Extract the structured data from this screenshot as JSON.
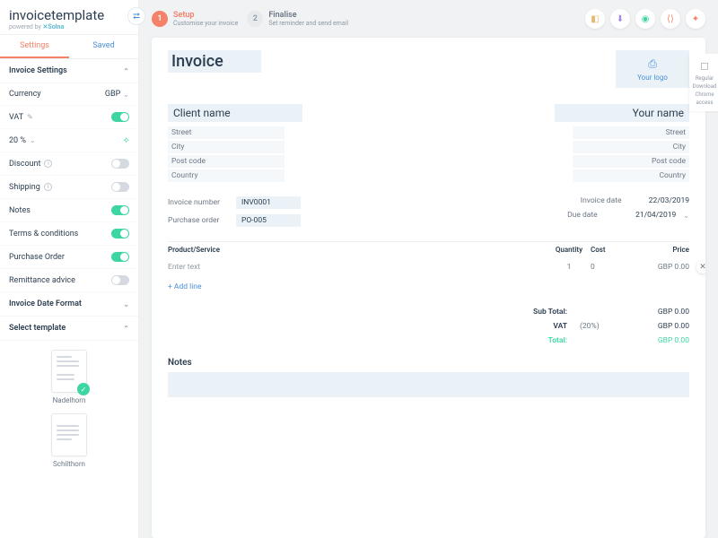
{
  "logo": {
    "name": "invoicetemplate",
    "powered_prefix": "powered by ",
    "powered_brand": "Solna"
  },
  "tabs": {
    "settings": "Settings",
    "saved": "Saved"
  },
  "sections": {
    "invoice_settings": "Invoice Settings",
    "invoice_date_format": "Invoice Date Format",
    "select_template": "Select template"
  },
  "settings": {
    "currency": {
      "label": "Currency",
      "value": "GBP"
    },
    "vat": {
      "label": "VAT",
      "percent": "20 %"
    },
    "discount": "Discount",
    "shipping": "Shipping",
    "notes": "Notes",
    "terms": "Terms & conditions",
    "po": "Purchase Order",
    "remittance": "Remittance advice"
  },
  "templates": {
    "nadelhorn": "Nadelhorn",
    "schilthorn": "Schilthorn"
  },
  "steps": {
    "s1": {
      "num": "1",
      "title": "Setup",
      "sub": "Customise your invoice"
    },
    "s2": {
      "num": "2",
      "title": "Finalise",
      "sub": "Set reminder and send email"
    }
  },
  "doc": {
    "title": "Invoice",
    "your_logo": "Your logo",
    "client": {
      "name": "Client name",
      "street": "Street",
      "city": "City",
      "post": "Post code",
      "country": "Country"
    },
    "you": {
      "name": "Your name",
      "street": "Street",
      "city": "City",
      "post": "Post code",
      "country": "Country"
    },
    "meta": {
      "inv_num_l": "Invoice number",
      "inv_num_v": "INV0001",
      "po_l": "Purchase order",
      "po_v": "PO-005",
      "inv_date_l": "Invoice date",
      "inv_date_v": "22/03/2019",
      "due_l": "Due date",
      "due_v": "21/04/2019"
    },
    "cols": {
      "prod": "Product/Service",
      "qty": "Quantity",
      "cost": "Cost",
      "price": "Price"
    },
    "line": {
      "prod": "Enter text",
      "qty": "1",
      "cost": "0",
      "price": "GBP 0.00"
    },
    "add_line": "+ Add line",
    "totals": {
      "sub_l": "Sub Total:",
      "sub_v": "GBP 0.00",
      "vat_l": "VAT",
      "vat_p": "(20%)",
      "vat_v": "GBP 0.00",
      "tot_l": "Total:",
      "tot_v": "GBP 0.00"
    },
    "notes": "Notes"
  },
  "side": {
    "l1": "Regular",
    "l2": "Download",
    "l3": "Chrome",
    "l4": "access"
  }
}
